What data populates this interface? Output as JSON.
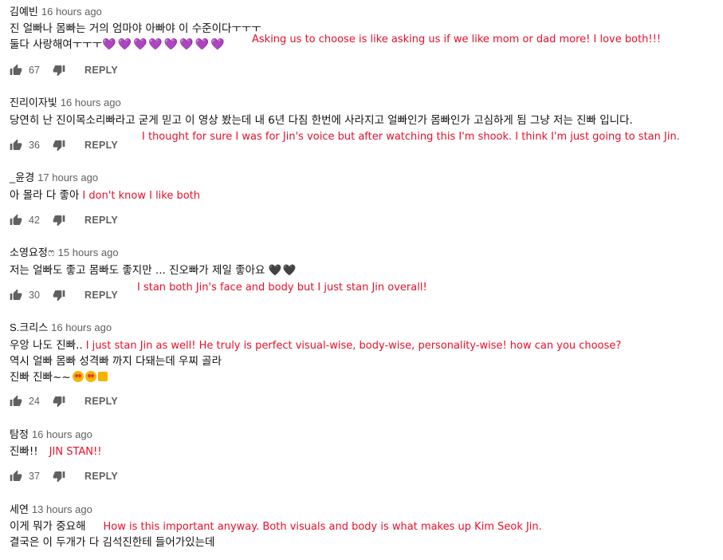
{
  "icons": {
    "like": "thumbs-up-icon",
    "dislike": "thumbs-down-icon"
  },
  "colors": {
    "translation": "#e8102b",
    "meta": "#606060",
    "hearts": "#7e57c2"
  },
  "reply_label": "REPLY",
  "comments": [
    {
      "author": "김예빈",
      "time": "16 hours ago",
      "lines": [
        "진 얼빠나 몸빠는 거의 엄마야 아빠야 이 수준이다ㅜㅜㅜ",
        "둘다 사랑해여ㅜㅜㅜ"
      ],
      "hearts": "💜💜💜💜💜💜💜💜",
      "translation": "Asking us to choose is like asking us if we like mom or dad more! I love both!!!",
      "likes": "67"
    },
    {
      "author": "진리이자빛",
      "time": "16 hours ago",
      "lines": [
        "당연히 난 진이목소리빠라고 굳게 믿고 이 영상 봤는데 내 6년 다짐 한번에 사라지고 얼빠인가 몸빠인가 고심하게 됨 그냥 저는 진빠 입니다."
      ],
      "translation": "I thought for sure I was for Jin's voice but after watching this I'm shook. I think I'm just going to stan Jin.",
      "likes": "36"
    },
    {
      "author": "_윤경",
      "time": "17 hours ago",
      "lines": [
        "아 몰라 다 좋아"
      ],
      "translation": "I don't know I like both",
      "likes": "42"
    },
    {
      "author": "소영요정ෆ",
      "time": "15 hours ago",
      "lines": [
        "저는 얼빠도 좋고 몸빠도 좋지만 ... 진오빠가 제일 좋아요"
      ],
      "hearts": "🖤🖤",
      "translation": "I stan both Jin's face and body but I just stan Jin overall!",
      "likes": "30"
    },
    {
      "author": "S.크리스",
      "time": "16 hours ago",
      "lines": [
        "우앙 나도 진빠..",
        "역시 얼빠 몸빠 성격빠 까지 다돼는데 우찌 골라",
        "진빠 진빠~~"
      ],
      "translation": "I just stan Jin as well! He truly is perfect visual-wise, body-wise, personality-wise! how can you choose?",
      "likes": "24"
    },
    {
      "author": "탐정",
      "time": "16 hours ago",
      "lines": [
        "진빠!!"
      ],
      "translation": "JIN STAN!!",
      "likes": "37"
    },
    {
      "author": "세연",
      "time": "13 hours ago",
      "lines": [
        "이게 뭐가 중요해",
        "결국은 이 두개가 다 김석진한테 들어가있는데"
      ],
      "translation": "How is this important anyway. Both visuals and body is what makes up Kim Seok Jin."
    }
  ]
}
